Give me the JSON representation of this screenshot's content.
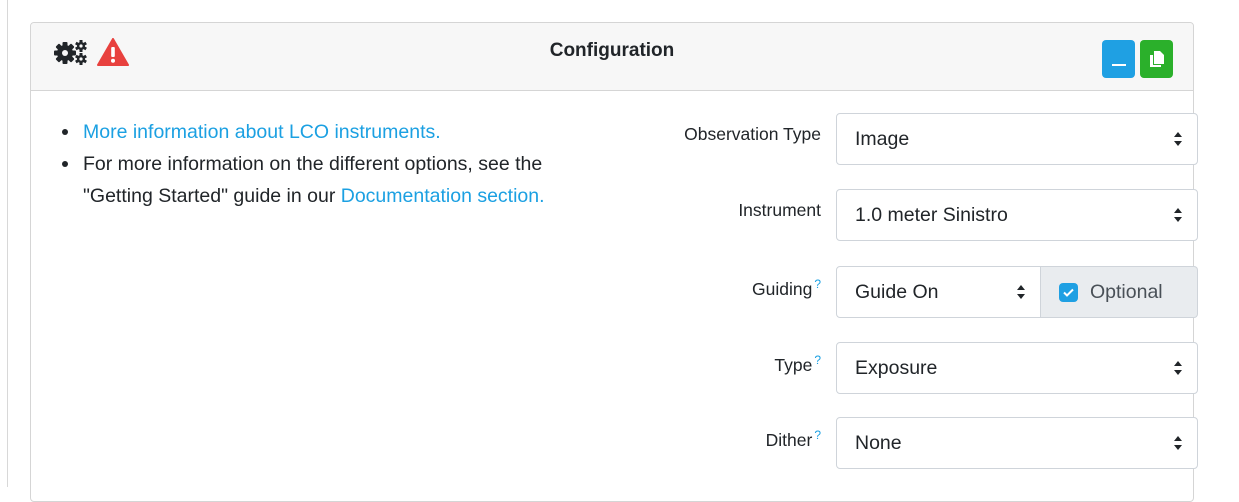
{
  "header": {
    "title": "Configuration",
    "icons": [
      "gears-icon",
      "warning-icon"
    ],
    "buttons": [
      "minimize-icon",
      "copy-icon"
    ]
  },
  "info": {
    "link1": "More information about LCO instruments.",
    "text2": "For more information on the different options, see the \"Getting Started\" guide in our ",
    "link2": "Documentation section."
  },
  "form": {
    "observation_type": {
      "label": "Observation Type",
      "value": "Image"
    },
    "instrument": {
      "label": "Instrument",
      "value": "1.0 meter Sinistro"
    },
    "guiding": {
      "label": "Guiding",
      "help": "?",
      "value": "Guide On",
      "optional_label": "Optional",
      "optional_checked": true
    },
    "type": {
      "label": "Type",
      "help": "?",
      "value": "Exposure"
    },
    "dither": {
      "label": "Dither",
      "help": "?",
      "value": "None"
    }
  },
  "colors": {
    "accent_blue": "#1fa0e3",
    "accent_green": "#2bb02b",
    "warning_red": "#e8413e",
    "link": "#1ba0e2"
  }
}
